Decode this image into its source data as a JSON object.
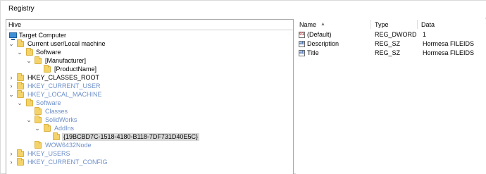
{
  "window": {
    "title": "Registry"
  },
  "tree": {
    "header": "Hive",
    "nodes": [
      {
        "label": "Target Computer",
        "icon": "computer-icon",
        "expanded": true
      },
      {
        "label": "Current user/Local machine",
        "expanded": true
      },
      {
        "label": "Software",
        "expanded": true
      },
      {
        "label": "[Manufacturer]",
        "expanded": true
      },
      {
        "label": "[ProductName]"
      },
      {
        "label": "HKEY_CLASSES_ROOT",
        "expanded": false
      },
      {
        "label": "HKEY_CURRENT_USER",
        "expanded": false,
        "dim": true
      },
      {
        "label": "HKEY_LOCAL_MACHINE",
        "expanded": true,
        "dim": true
      },
      {
        "label": "Software",
        "expanded": true,
        "dim": true
      },
      {
        "label": "Classes",
        "dim": true
      },
      {
        "label": "SolidWorks",
        "expanded": true,
        "dim": true
      },
      {
        "label": "AddIns",
        "expanded": true,
        "dim": true
      },
      {
        "label": "{19BCBD7C-1518-4180-B118-7DF731D40E5C}",
        "selected": true
      },
      {
        "label": "WOW6432Node",
        "dim": true
      },
      {
        "label": "HKEY_USERS",
        "expanded": false,
        "dim": true
      },
      {
        "label": "HKEY_CURRENT_CONFIG",
        "expanded": false,
        "dim": true
      }
    ]
  },
  "values": {
    "columns": {
      "name": "Name",
      "type": "Type",
      "data": "Data"
    },
    "rows": [
      {
        "name": "(Default)",
        "type": "REG_DWORD",
        "data": "1",
        "icon": "dword-value-icon"
      },
      {
        "name": "Description",
        "type": "REG_SZ",
        "data": "Hormesa FILEIDS",
        "icon": "string-value-icon"
      },
      {
        "name": "Title",
        "type": "REG_SZ",
        "data": "Hormesa FILEIDS",
        "icon": "string-value-icon"
      }
    ]
  },
  "colors": {
    "folder": "#f5d36b",
    "dim_text": "#6d8fc9",
    "selected_bg": "#d9d9d9"
  }
}
